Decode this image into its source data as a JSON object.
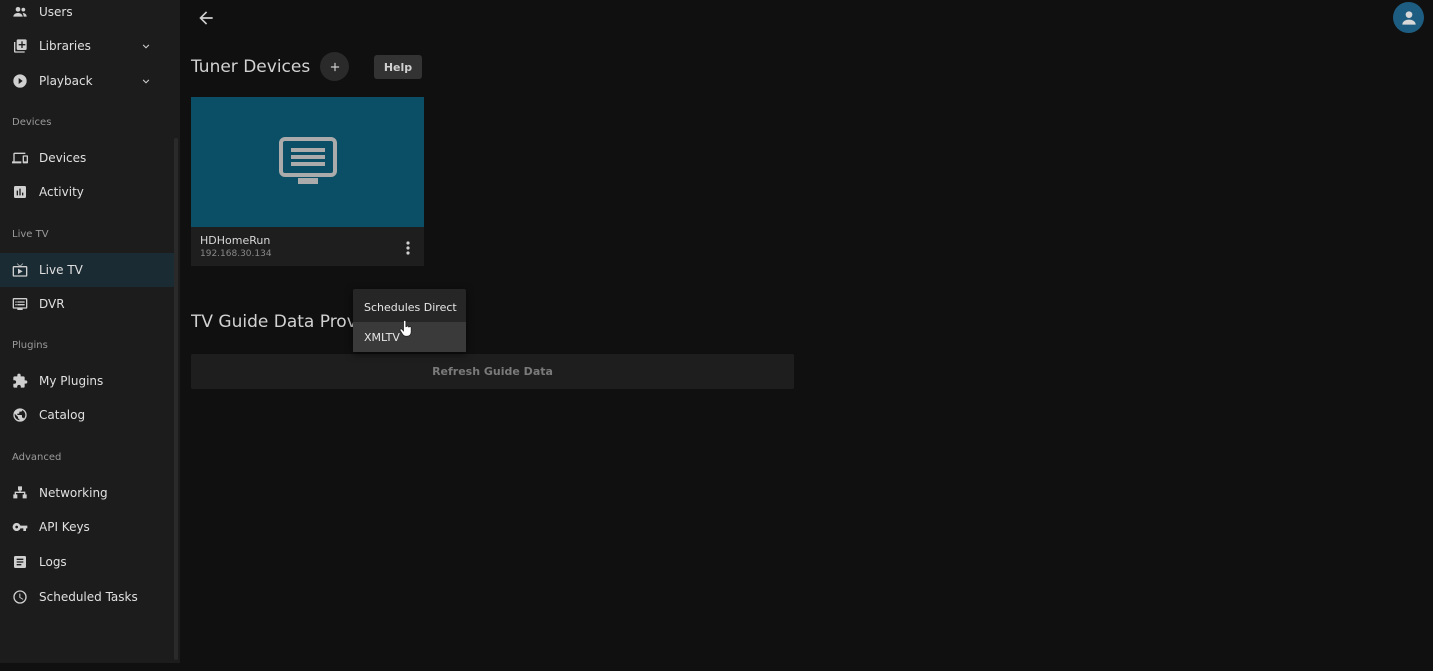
{
  "sidebar": {
    "items": [
      {
        "label": "Users",
        "icon": "users-icon"
      },
      {
        "label": "Libraries",
        "icon": "libraries-icon"
      },
      {
        "label": "Playback",
        "icon": "playback-icon"
      },
      {
        "label": "Devices",
        "icon": "devices-icon"
      },
      {
        "label": "Activity",
        "icon": "activity-icon"
      },
      {
        "label": "Live TV",
        "icon": "live-tv-icon"
      },
      {
        "label": "DVR",
        "icon": "dvr-icon"
      },
      {
        "label": "My Plugins",
        "icon": "puzzle-icon"
      },
      {
        "label": "Catalog",
        "icon": "globe-icon"
      },
      {
        "label": "Networking",
        "icon": "network-icon"
      },
      {
        "label": "API Keys",
        "icon": "key-icon"
      },
      {
        "label": "Logs",
        "icon": "logs-icon"
      },
      {
        "label": "Scheduled Tasks",
        "icon": "clock-icon"
      }
    ],
    "sections": {
      "devices": "Devices",
      "live_tv": "Live TV",
      "plugins": "Plugins",
      "advanced": "Advanced"
    },
    "active_item": "Live TV"
  },
  "main": {
    "tuner_title": "Tuner Devices",
    "help_label": "Help",
    "device": {
      "name": "HDHomeRun",
      "ip": "192.168.30.134"
    },
    "guide_title": "TV Guide Data Providers",
    "refresh_label": "Refresh Guide Data"
  },
  "menu": {
    "items": [
      {
        "label": "Schedules Direct"
      },
      {
        "label": "XMLTV"
      }
    ]
  },
  "colors": {
    "accent": "#1e5d82",
    "card_thumb": "#0b4f66",
    "active_nav": "#1b2b33",
    "background": "#101010"
  }
}
